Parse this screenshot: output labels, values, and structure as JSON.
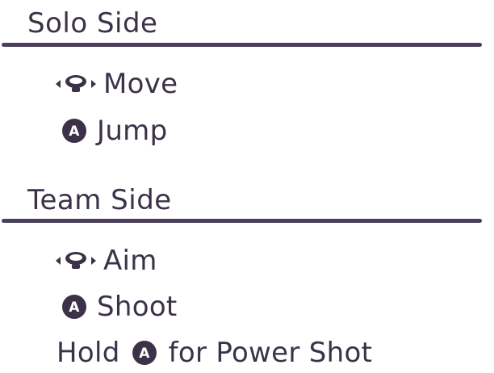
{
  "colors": {
    "text": "#3b3248",
    "divider": "#4a3f5c",
    "icon": "#3b3248"
  },
  "solo": {
    "title": "Solo Side",
    "controls": [
      {
        "icon": "control-stick-icon",
        "label": "Move"
      },
      {
        "icon": "a-button-icon",
        "label": "Jump"
      }
    ]
  },
  "team": {
    "title": "Team Side",
    "controls": [
      {
        "icon": "control-stick-icon",
        "label": "Aim"
      },
      {
        "icon": "a-button-icon",
        "label": "Shoot"
      }
    ],
    "hold": {
      "prefix": "Hold",
      "icon": "a-button-icon",
      "suffix": "for Power Shot"
    }
  },
  "a_button_glyph": "A"
}
